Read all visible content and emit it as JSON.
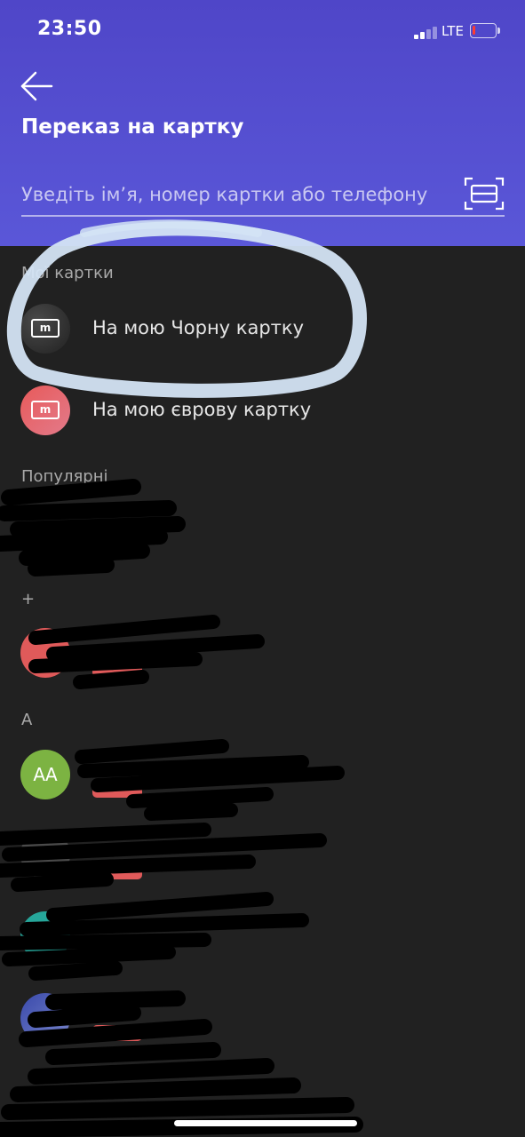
{
  "status_bar": {
    "time": "23:50",
    "network": "LTE",
    "signal_bars": 2,
    "battery_level": 0.15
  },
  "header": {
    "back_icon": "arrow-left-icon",
    "title": "Переказ на картку",
    "search_placeholder": "Уведіть ім’я, номер картки або телефону",
    "scan_icon": "card-scan-icon"
  },
  "my_cards": {
    "label": "Мої картки",
    "items": [
      {
        "label": "На мою Чорну картку",
        "icon": "monobank-card-icon",
        "color": "#333333"
      },
      {
        "label": "На мою єврову картку",
        "icon": "monobank-card-icon",
        "color": "#e06a6a"
      }
    ]
  },
  "popular": {
    "label": "Популярні"
  },
  "contacts": {
    "groups": [
      {
        "letter": "+"
      },
      {
        "letter": "А"
      }
    ],
    "items": [
      {
        "initials": "",
        "color": "#e05a5a",
        "badge_color": "#e05a5a"
      },
      {
        "initials": "АА",
        "color": "#7cb342",
        "badge_color": "#e05a5a"
      },
      {
        "initials": "",
        "color": "#4a4a4a",
        "badge_color": "#e05a5a"
      },
      {
        "initials": "",
        "color": "#26a69a",
        "badge_color": "#e05a5a"
      },
      {
        "initials": "",
        "color": "#3f51b5",
        "badge_color": "#e05a5a"
      }
    ]
  },
  "colors": {
    "header_bg": "#5251d4",
    "body_bg": "#212121",
    "accent": "#e05a5a",
    "annotation_stroke": "#d4e4f4"
  }
}
